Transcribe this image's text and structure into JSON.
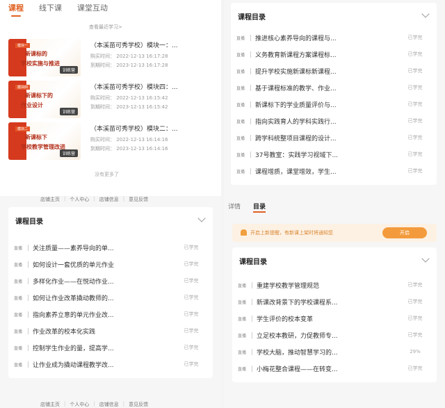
{
  "left": {
    "tabs": [
      "课程",
      "线下课",
      "课堂互动"
    ],
    "see_recent": "查看最近学习>",
    "courses": [
      {
        "title": "（本溪苗可秀学校）模块一：...",
        "purchase_time": "购买时间： 2022-12-13 16:17:28",
        "expire_time": "到期时间： 2023-12-13 16:17:28",
        "thumb_tag": "模块一",
        "thumb_line1": "新课标的",
        "thumb_line2": "学校实施与推进",
        "thumb_badge": "训练营"
      },
      {
        "title": "（本溪苗可秀学校）模块四：...",
        "purchase_time": "购买时间： 2022-12-13 16:15:42",
        "expire_time": "到期时间： 2023-12-13 16:15:42",
        "thumb_tag": "模块四",
        "thumb_line1": "新课标下的",
        "thumb_line2": "作业设计",
        "thumb_badge": "训练营"
      },
      {
        "title": "（本溪苗可秀学校）模块二：...",
        "purchase_time": "购买时间： 2022-12-13 16:14:16",
        "expire_time": "到期时间： 2023-12-13 16:14:16",
        "thumb_tag": "模块二",
        "thumb_line1": "新课标下",
        "thumb_line2": "学校教学管理改进",
        "thumb_badge": "训练营"
      }
    ],
    "no_more": "没有更多了",
    "footer": [
      "店铺主页",
      "个人中心",
      "店铺信息",
      "意见反馈"
    ],
    "footer_bottom": [
      "店铺主页",
      "个人中心",
      "店铺信息",
      "意见反馈"
    ],
    "catalog": {
      "title": "课程目录",
      "items": [
        {
          "type": "直播",
          "name": "关注质量——素养导向的单...",
          "status": "已学完"
        },
        {
          "type": "直播",
          "name": "如何设计一套优质的单元作业",
          "status": "已学完"
        },
        {
          "type": "直播",
          "name": "多样化作业——在悦动作业...",
          "status": "已学完"
        },
        {
          "type": "直播",
          "name": "如何让作业改革撬动教师的...",
          "status": "已学完"
        },
        {
          "type": "直播",
          "name": "指向素养立意的单元作业改...",
          "status": "已学完"
        },
        {
          "type": "直播",
          "name": "作业改革的校本化实践",
          "status": "已学完"
        },
        {
          "type": "直播",
          "name": "控制学生作业的量，提高学...",
          "status": "已学完"
        },
        {
          "type": "直播",
          "name": "让作业成为撬动课程教学改...",
          "status": "已学完"
        }
      ]
    }
  },
  "right": {
    "catalog_top": {
      "title": "课程目录",
      "items": [
        {
          "type": "直播",
          "name": "推进核心素养导向的课程与...",
          "status": "已学完"
        },
        {
          "type": "直播",
          "name": "义务教育新课程方案课程标...",
          "status": "已学完"
        },
        {
          "type": "直播",
          "name": "提升学校实施新课标新课程...",
          "status": "已学完"
        },
        {
          "type": "直播",
          "name": "基于课程标准的教学、作业...",
          "status": "已学完"
        },
        {
          "type": "直播",
          "name": "新课标下的学业质量评价与...",
          "status": "已学完"
        },
        {
          "type": "直播",
          "name": "指向实践育人的学科实践行...",
          "status": "已学完"
        },
        {
          "type": "直播",
          "name": "跨学科统整项目课程的设计...",
          "status": "已学完"
        },
        {
          "type": "直播",
          "name": "37号教室：实践学习视域下...",
          "status": "已学完"
        },
        {
          "type": "直播",
          "name": "课程增质，课堂增效，学生...",
          "status": "已学完"
        }
      ]
    },
    "detail_tabs": [
      "详情",
      "目录"
    ],
    "notice": {
      "message": "开启上新提醒，有新课上架时将通知您",
      "button": "开启"
    },
    "catalog_bottom": {
      "title": "课程目录",
      "items": [
        {
          "type": "直播",
          "name": "重建学校教学管理规范",
          "status": "已学完"
        },
        {
          "type": "直播",
          "name": "新课改背景下的学校课程系...",
          "status": "已学完"
        },
        {
          "type": "直播",
          "name": "学生评价的校本变革",
          "status": "已学完"
        },
        {
          "type": "直播",
          "name": "立足校本教研，力促教师专...",
          "status": "已学完"
        },
        {
          "type": "直播",
          "name": "学校大脑，推动智慧学习的...",
          "status": "29%"
        },
        {
          "type": "直播",
          "name": "小梅花整合课程——在转变...",
          "status": "已学完"
        }
      ]
    }
  },
  "colors": {
    "accent": "#e06020",
    "thumb_red": "#d53a1e",
    "notice_bg": "#fdf1e4",
    "notice_button": "#f39b3c"
  }
}
